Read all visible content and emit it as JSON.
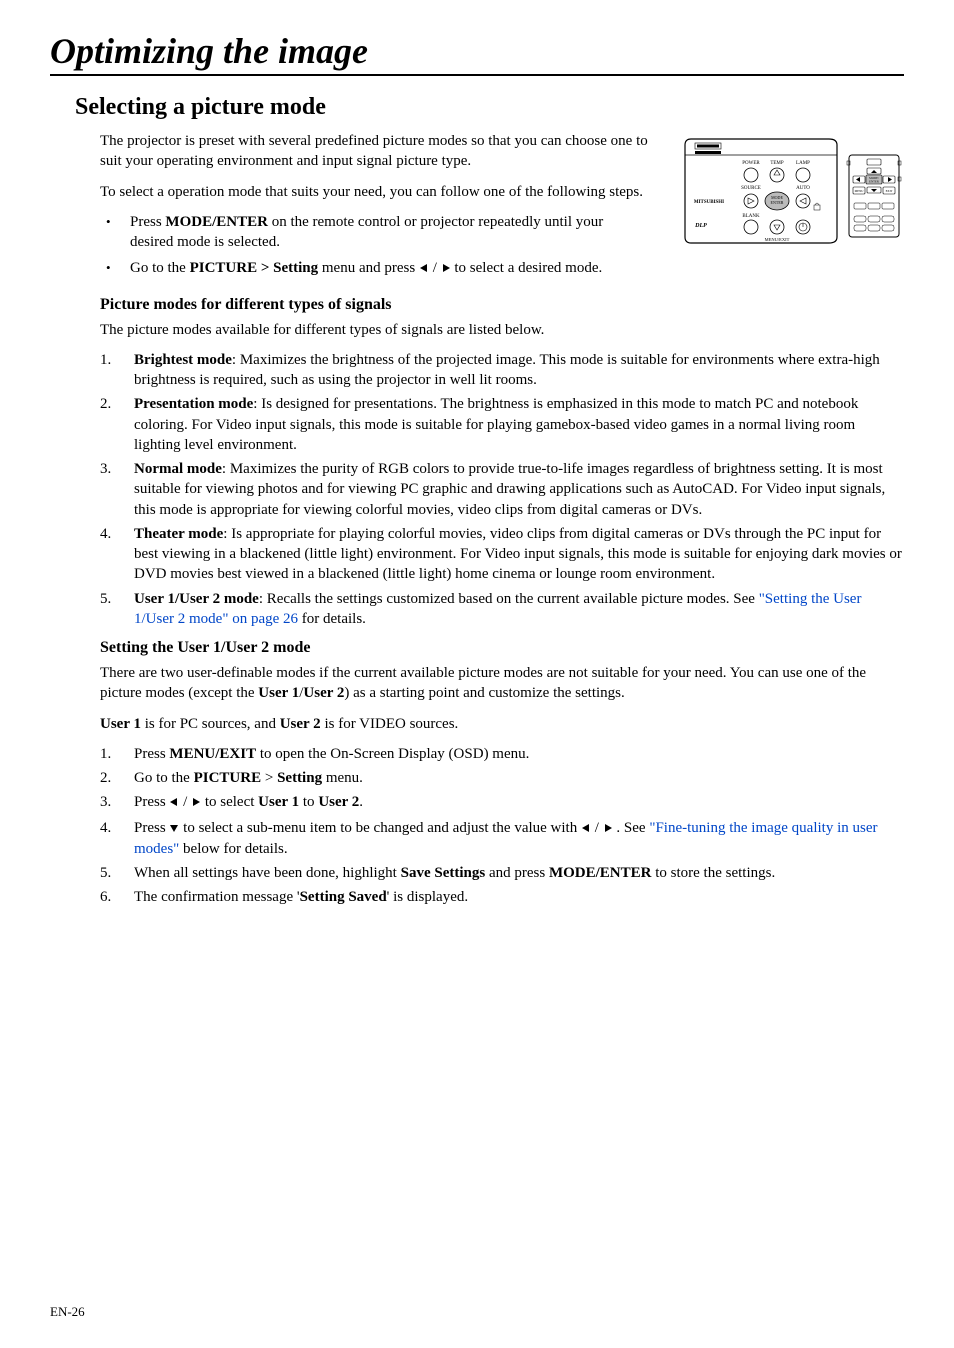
{
  "footer": "EN-26",
  "title": "Optimizing the image",
  "h2": "Selecting a picture mode",
  "intro1": "The projector is preset with several predefined picture modes so that you can choose one to suit your operating environment and input signal picture type.",
  "intro2": "To select a operation mode that suits your need, you can follow one of the following steps.",
  "bul1a": "Press ",
  "bul1b": "MODE/ENTER",
  "bul1c": " on the remote control or projector repeatedly until your desired mode is selected.",
  "bul2a": "Go to the ",
  "bul2b": "PICTURE > Setting",
  "bul2c": " menu and press ",
  "bul2d": " / ",
  "bul2e": " to select a desired mode.",
  "h3a": "Picture modes for different types of signals",
  "intro3": "The picture modes available for different types of signals are listed below.",
  "modes": [
    {
      "n": "1.",
      "name": "Brightest mode",
      "desc": ": Maximizes the brightness of the projected image. This mode is suitable for environments where extra-high brightness is required, such as using the projector in well lit rooms."
    },
    {
      "n": "2.",
      "name": "Presentation mode",
      "desc": ": Is designed for presentations. The brightness is emphasized in this mode to match PC and notebook coloring. For Video input signals, this mode is suitable for playing gamebox-based video games in a normal living room lighting level environment."
    },
    {
      "n": "3.",
      "name": "Normal mode",
      "desc": ": Maximizes the purity of RGB colors to provide true-to-life images regardless of brightness setting. It is most suitable for viewing photos and for viewing PC graphic and drawing applications such as AutoCAD. For Video input signals, this mode is appropriate for viewing colorful movies, video clips from digital cameras or DVs."
    },
    {
      "n": "4.",
      "name": "Theater mode",
      "desc": ":  Is appropriate for playing colorful movies, video clips from digital cameras or DVs through the PC input for best viewing in a blackened (little light) environment. For Video input signals, this mode is suitable for enjoying dark movies or DVD movies best viewed in a blackened (little light) home cinema or lounge room environment."
    }
  ],
  "mode5n": "5.",
  "mode5name": "User 1/User 2 mode",
  "mode5desc1": ": Recalls the settings customized based on the current available picture modes. See ",
  "mode5link": "\"Setting the User 1/User 2 mode\" on page 26",
  "mode5desc2": " for details.",
  "h3b": "Setting the User 1/User 2 mode",
  "user12a": "There are two user-definable modes if the current available picture modes are not suitable for your need. You can use one of the picture modes (except the ",
  "user12b": "User 1",
  "user12c": "/",
  "user12d": "User 2",
  "user12e": ") as a starting point and customize the settings.",
  "userline_a": "User 1",
  "userline_b": " is for PC sources, and ",
  "userline_c": "User 2",
  "userline_d": " is for VIDEO sources.",
  "steps": {
    "s1": {
      "n": "1.",
      "a": "Press ",
      "b": "MENU/EXIT",
      "c": " to open the On-Screen Display (OSD) menu."
    },
    "s2": {
      "n": "2.",
      "a": "Go to the ",
      "b": "PICTURE",
      "c": " > ",
      "d": "Setting",
      "e": " menu."
    },
    "s3": {
      "n": "3.",
      "a": "Press ",
      "b": " / ",
      "c": " to select ",
      "d": "User 1",
      "e": " to ",
      "f": "User 2",
      "g": "."
    },
    "s4": {
      "n": "4.",
      "a": "Press ",
      "b": " to select a sub-menu item to be changed and adjust the value with ",
      "c": " / ",
      "d": " . See ",
      "link": "\"Fine-tuning the image quality in user modes\"",
      "e": " below for details."
    },
    "s5": {
      "n": "5.",
      "a": "When all settings have been done, highlight ",
      "b": "Save Settings",
      "c": " and press ",
      "d": "MODE/ENTER",
      "e": " to store the settings."
    },
    "s6": {
      "n": "6.",
      "a": "The confirmation message '",
      "b": "Setting Saved",
      "c": "' is displayed."
    }
  },
  "illus_labels": {
    "power": "POWER",
    "temp": "TEMP",
    "lamp": "LAMP",
    "source": "SOURCE",
    "auto": "AUTO",
    "mode_enter": "MODE\nENTER",
    "blank": "BLANK",
    "menu_exit": "MENU/EXIT",
    "brand": "MITSUBISHI",
    "dlp": "DLP",
    "r_mode_enter": "MODE/\nENTER",
    "r_menu": "MENU"
  }
}
